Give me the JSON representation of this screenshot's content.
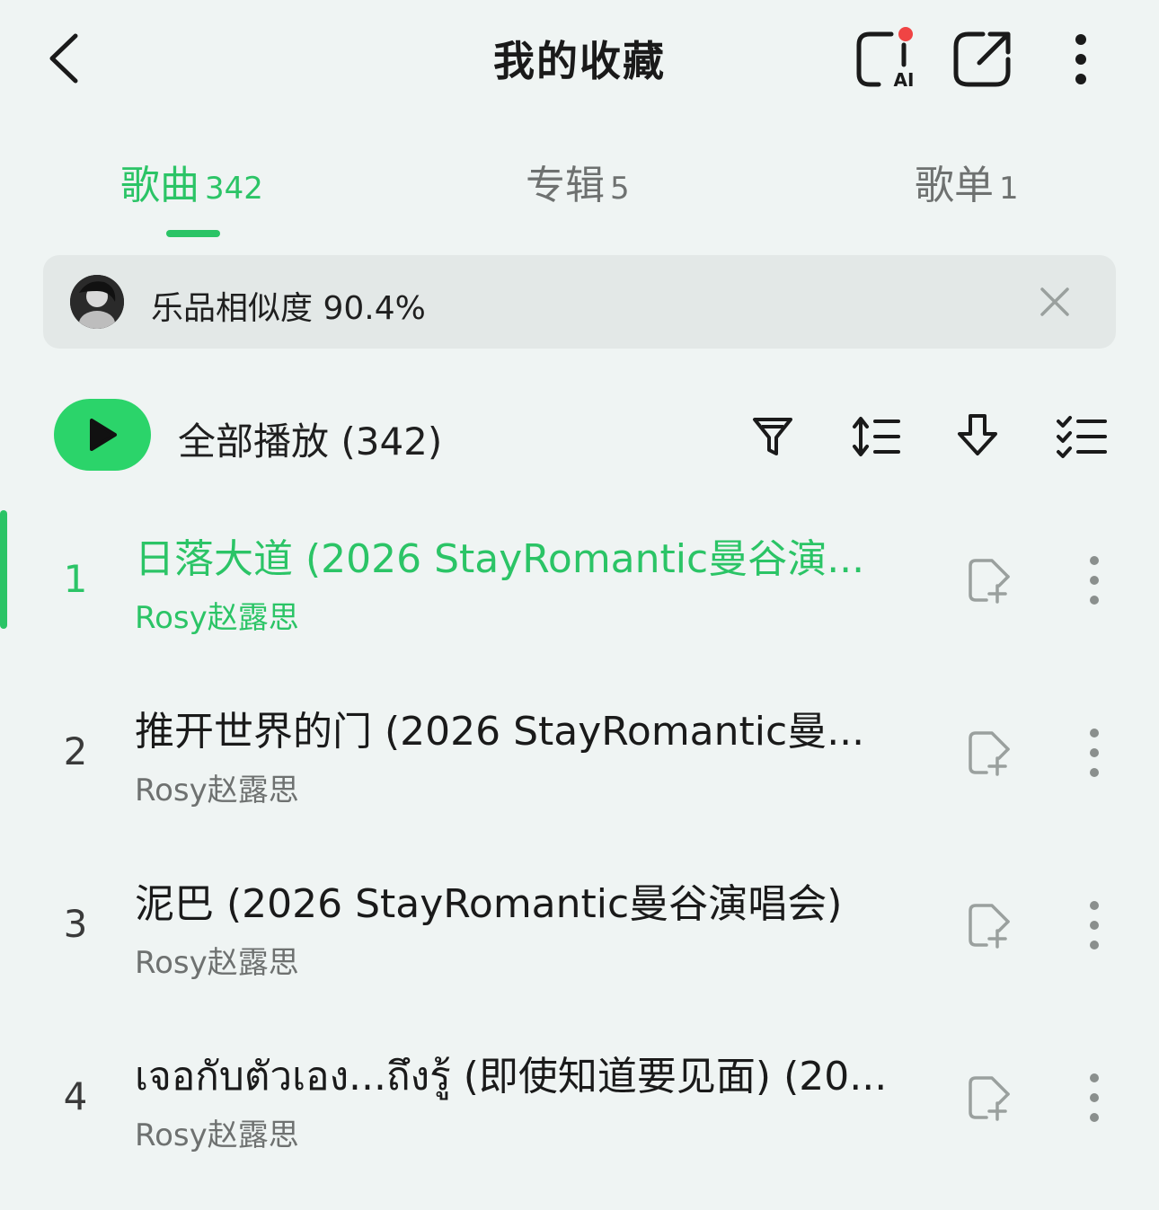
{
  "header": {
    "title": "我的收藏",
    "back_icon": "chevron-left-icon",
    "ai_icon": "ai-assistant-icon",
    "ai_badge_text": "AI",
    "share_icon": "share-icon",
    "more_icon": "more-vertical-icon"
  },
  "tabs": [
    {
      "label": "歌曲",
      "count": "342",
      "active": true
    },
    {
      "label": "专辑",
      "count": "5",
      "active": false
    },
    {
      "label": "歌单",
      "count": "1",
      "active": false
    }
  ],
  "banner": {
    "text": "乐品相似度 90.4%",
    "close_icon": "close-icon"
  },
  "toolbar": {
    "play_all_label": "全部播放 (342)",
    "icons": [
      "filter-icon",
      "sort-icon",
      "download-icon",
      "multi-select-icon"
    ]
  },
  "songs": [
    {
      "index": "1",
      "title": "日落大道 (2026 StayRomantic曼谷演...",
      "artist": "Rosy赵露思",
      "playing": true
    },
    {
      "index": "2",
      "title": "推开世界的门 (2026 StayRomantic曼...",
      "artist": "Rosy赵露思",
      "playing": false
    },
    {
      "index": "3",
      "title": "泥巴 (2026 StayRomantic曼谷演唱会)",
      "artist": "Rosy赵露思",
      "playing": false
    },
    {
      "index": "4",
      "title": "เจอกับตัวเอง...ถึงรู้ (即使知道要见面) (20...",
      "artist": "Rosy赵露思",
      "playing": false
    }
  ],
  "colors": {
    "accent": "#2bc466",
    "play_button": "#2bd46a",
    "background": "#eff4f3",
    "ai_dot": "#f04444"
  }
}
